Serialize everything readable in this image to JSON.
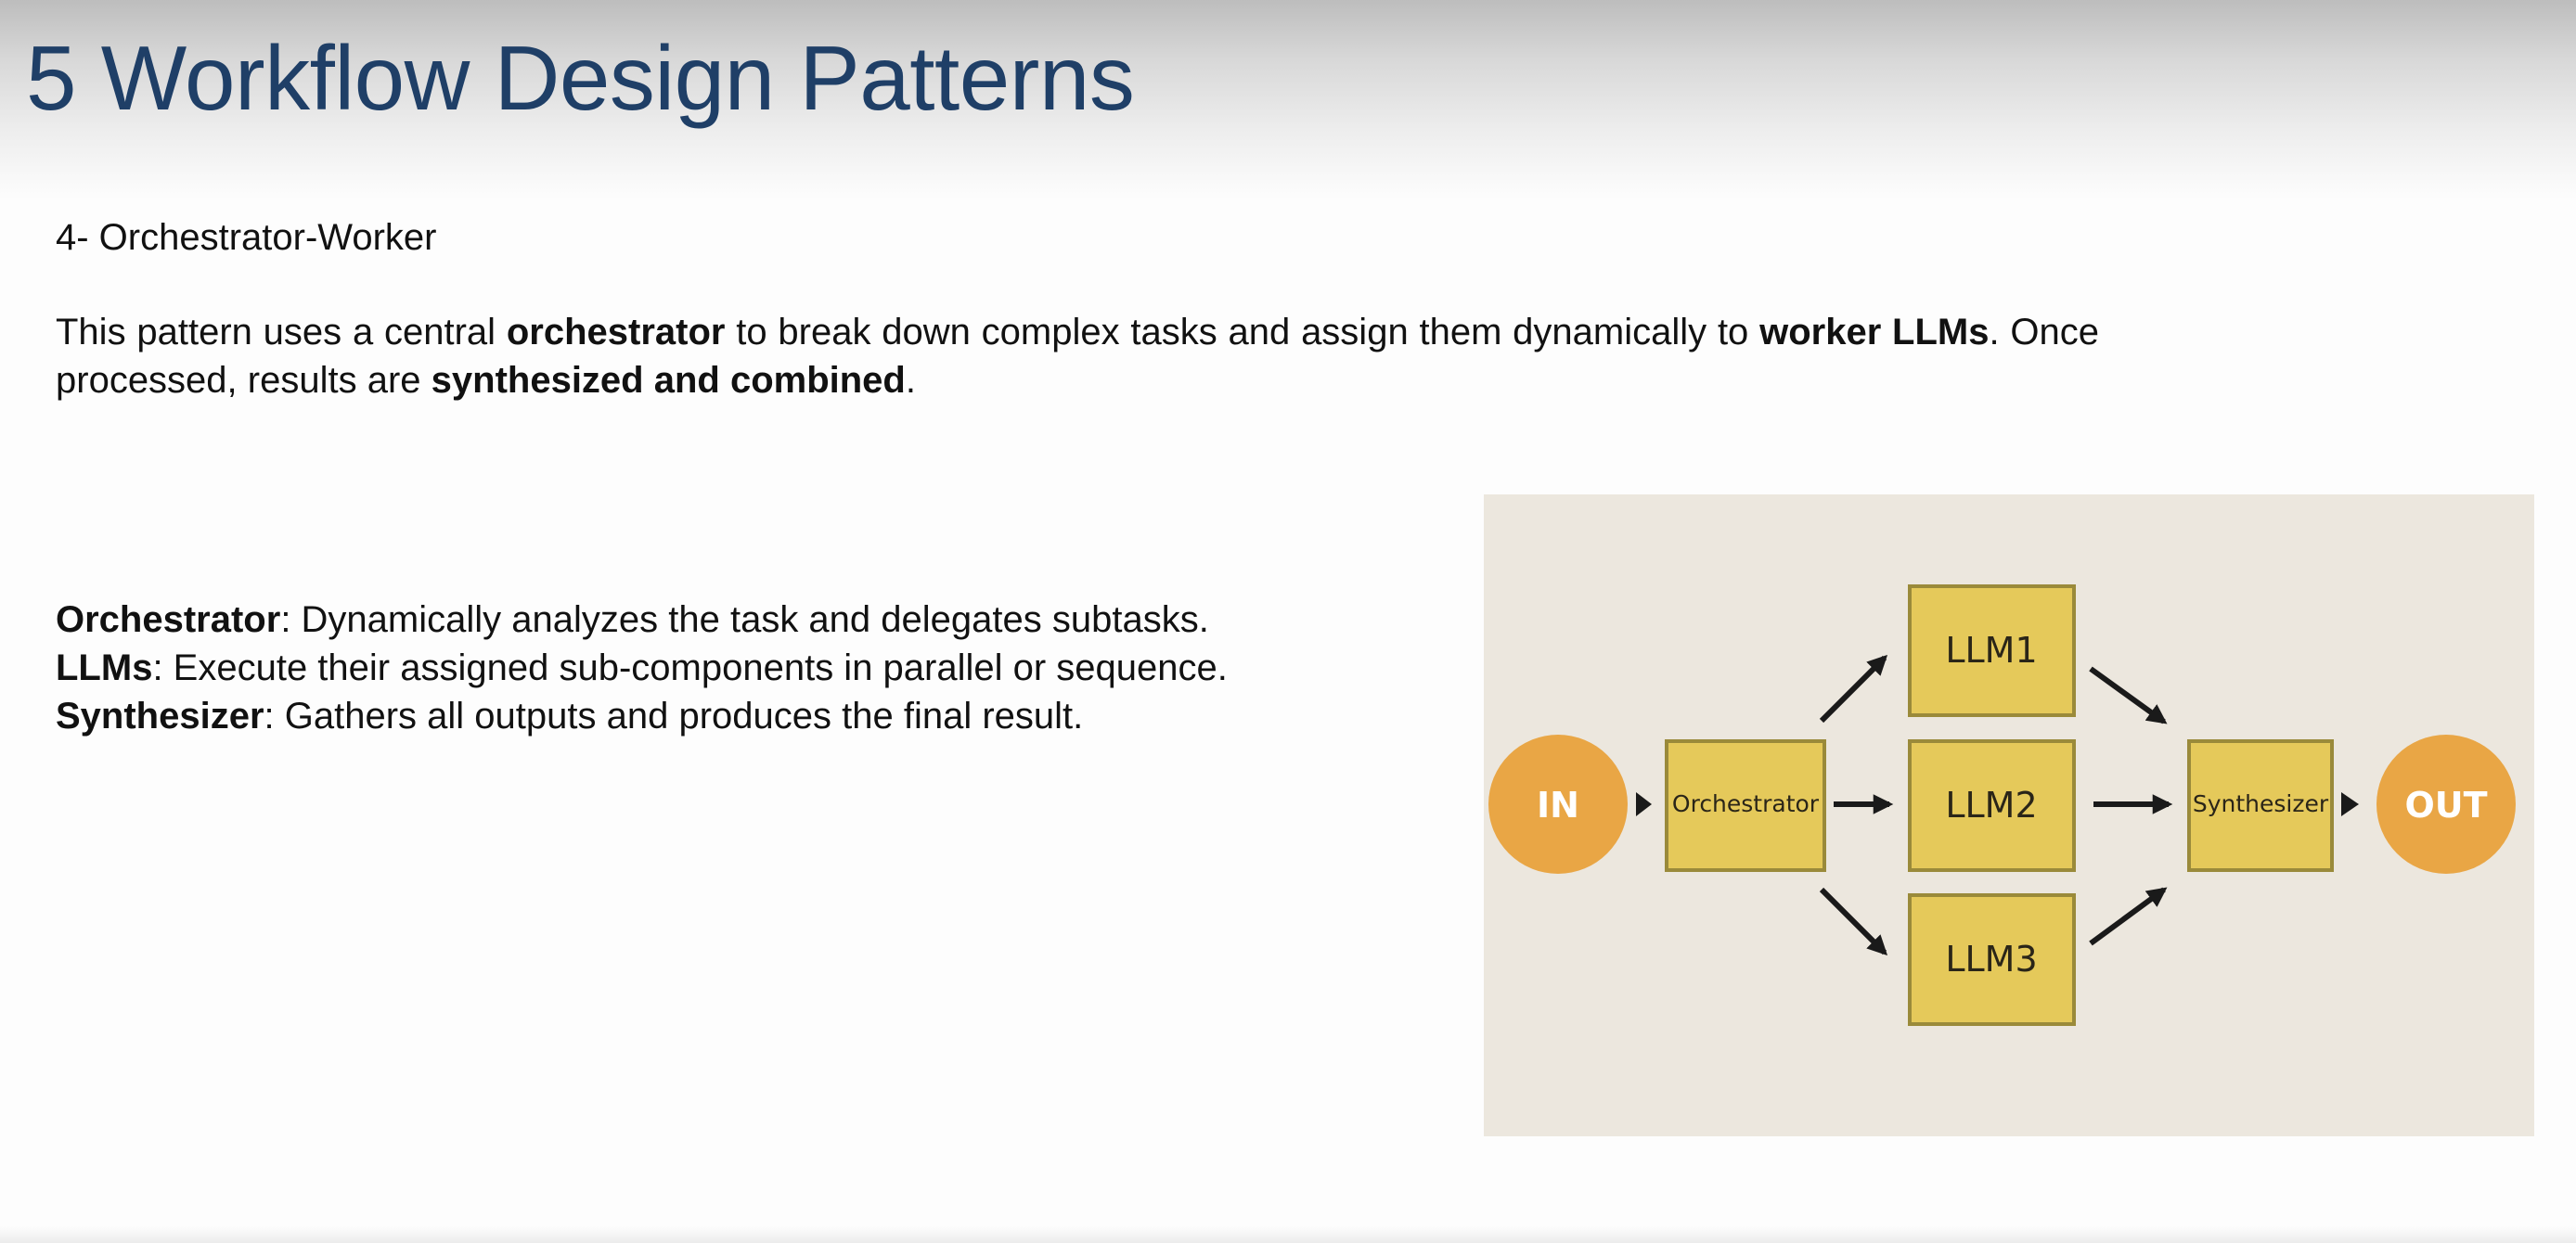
{
  "slide": {
    "title": "5 Workflow Design Patterns",
    "section": "4- Orchestrator-Worker",
    "intro": {
      "t1": "This pattern uses a central ",
      "b1": "orchestrator",
      "t2": " to break down complex tasks and assign them dynamically to ",
      "b2": "worker LLMs",
      "t3": ". Once processed, results are ",
      "b3": "synthesized and combined",
      "t4": "."
    },
    "definitions": [
      {
        "term": "Orchestrator",
        "text": ": Dynamically analyzes the task and delegates subtasks."
      },
      {
        "term": "LLMs",
        "text": ": Execute their assigned sub-components in parallel or sequence."
      },
      {
        "term": "Synthesizer",
        "text": ": Gathers all outputs and produces the final result."
      }
    ]
  },
  "diagram": {
    "nodes": {
      "in": "IN",
      "orchestrator": "Orchestrator",
      "llm1": "LLM1",
      "llm2": "LLM2",
      "llm3": "LLM3",
      "synthesizer": "Synthesizer",
      "out": "OUT"
    },
    "colors": {
      "background": "#ece7de",
      "circle_fill": "#e9a645",
      "box_fill": "#e5c95a",
      "box_stroke": "#9a8a3a",
      "arrow": "#1a1a1a",
      "title": "#1f3f67"
    }
  }
}
